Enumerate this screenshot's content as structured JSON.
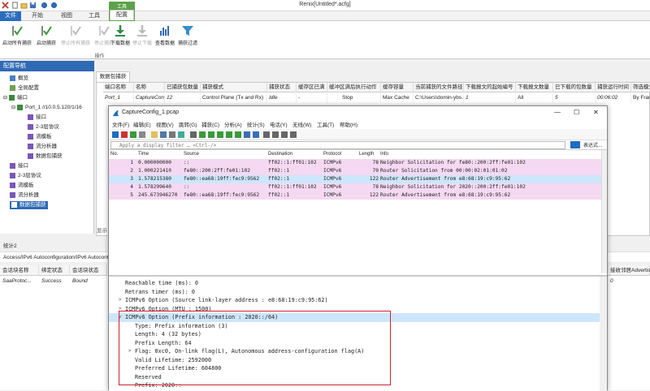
{
  "app": {
    "title": "Renix[Untitled*.acfg]"
  },
  "ribbon": {
    "tabs": [
      "文件",
      "开始",
      "视图",
      "工具",
      "配置"
    ],
    "context_tab": "工具",
    "buttons": [
      {
        "label": "启动所有捕获",
        "icon": "start-all-capture-icon",
        "enabled": true
      },
      {
        "label": "启动捕获",
        "icon": "start-capture-icon",
        "enabled": true
      },
      {
        "label": "停止所有捕获",
        "icon": "stop-all-capture-icon",
        "enabled": false
      },
      {
        "label": "停止捕获",
        "icon": "stop-capture-icon",
        "enabled": false
      },
      {
        "label": "下载数据",
        "icon": "download-data-icon",
        "enabled": true
      },
      {
        "label": "停止下载",
        "icon": "stop-download-icon",
        "enabled": false
      },
      {
        "label": "查看数据",
        "icon": "view-data-icon",
        "enabled": true
      },
      {
        "label": "捕获过滤",
        "icon": "capture-filter-icon",
        "enabled": true
      }
    ],
    "group_label": "操作"
  },
  "nav": {
    "header": "配置导航",
    "items": [
      {
        "label": "概览",
        "indent": 0
      },
      {
        "label": "全局配置",
        "indent": 0
      },
      {
        "label": "端口",
        "indent": 0
      },
      {
        "label": "Port_1 //10.0.5.120/1/16",
        "indent": 1
      },
      {
        "label": "接口",
        "indent": 2
      },
      {
        "label": "2-3层协议",
        "indent": 2
      },
      {
        "label": "流模板",
        "indent": 2
      },
      {
        "label": "流分析器",
        "indent": 2
      },
      {
        "label": "数据包捕获",
        "indent": 2
      },
      {
        "label": "接口",
        "indent": 0
      },
      {
        "label": "2-3层协议",
        "indent": 0
      },
      {
        "label": "流模板",
        "indent": 0
      },
      {
        "label": "流分析器",
        "indent": 0
      },
      {
        "label": "数据包捕获",
        "indent": 0,
        "selected": true
      }
    ]
  },
  "capture_panel": {
    "tab": "数据包捕获",
    "columns": [
      "端口名称",
      "名称",
      "已捕获包数量",
      "捕获模式",
      "捕获状态",
      "缓存区已满",
      "缓冲区满后执行动作",
      "缓存容量",
      "当前捕获的文件路径",
      "下载报文的起始编号",
      "下载报文数量",
      "已下载的包数量",
      "捕获运行时间",
      "筛选模式"
    ],
    "row": [
      "Port_1",
      "CaptureConf...",
      "12",
      "Control Plane (Tx and Rx)",
      "Idle",
      "-",
      "Stop",
      "Max Cache",
      "C:\\Users\\domin-ybs...",
      "1",
      "All",
      "5",
      "00:06:02",
      "By Fram"
    ],
    "side_label": "显示"
  },
  "stats": {
    "title": "统计2",
    "path": "Access/IPv6 Autoconfiguration/IPv6 Autoconfig",
    "columns": [
      "会话块名称",
      "绑定状态",
      "会话块状态"
    ],
    "row": [
      "SaaProtoc...",
      "Success",
      "Bound"
    ],
    "extra_col": "接收邻居Advertis",
    "extra_val": "0"
  },
  "wireshark": {
    "title": "CaptureConfig_1.pcap",
    "menu": [
      "文件(F)",
      "编辑(E)",
      "视图(V)",
      "跳转(G)",
      "捕获(C)",
      "分析(A)",
      "统计(S)",
      "电话(Y)",
      "无线(W)",
      "工具(T)",
      "帮助(H)"
    ],
    "filter_placeholder": "Apply a display filter … <Ctrl-/>",
    "expression_label": "表达式…",
    "packet_columns": [
      "No.",
      "Time",
      "Source",
      "Destination",
      "Protocol",
      "Length",
      "Info"
    ],
    "packets": [
      {
        "no": "1",
        "time": "0.000000000",
        "src": "::",
        "dst": "ff02::1:ff01:102",
        "proto": "ICMPv6",
        "len": "78",
        "info": "Neighbor Solicitation for fe80::200:2ff:fe01:102"
      },
      {
        "no": "2",
        "time": "1.000221410",
        "src": "fe80::200:2ff:fe01:102",
        "dst": "ff02::1",
        "proto": "ICMPv6",
        "len": "70",
        "info": "Router Solicitation from 00:00:02:01:01:02"
      },
      {
        "no": "3",
        "time": "1.578215380",
        "src": "fe80::ea68:19ff:fec9:9562",
        "dst": "ff02::1",
        "proto": "ICMPv6",
        "len": "122",
        "info": "Router Advertisement from e8:68:19:c9:95:62"
      },
      {
        "no": "4",
        "time": "1.578299640",
        "src": "::",
        "dst": "ff02::1:ff01:102",
        "proto": "ICMPv6",
        "len": "78",
        "info": "Neighbor Solicitation for 2020::200:2ff:fe01:102"
      },
      {
        "no": "5",
        "time": "245.673946270",
        "src": "fe80::ea68:19ff:fec9:9562",
        "dst": "ff02::1",
        "proto": "ICMPv6",
        "len": "122",
        "info": "Router Advertisement from e8:68:19:c9:95:62"
      }
    ],
    "selected_packet": "3",
    "detail_lines": [
      {
        "text": "Reachable time (ms): 0",
        "indent": 1,
        "arrow": ""
      },
      {
        "text": "Retrans timer (ms): 0",
        "indent": 1,
        "arrow": ""
      },
      {
        "text": "ICMPv6 Option (Source link-layer address : e8:68:19:c9:95:62)",
        "indent": 1,
        "arrow": ">"
      },
      {
        "text": "ICMPv6 Option (MTU : 1500)",
        "indent": 1,
        "arrow": ">"
      },
      {
        "text": "ICMPv6 Option (Prefix information : 2020::/64)",
        "indent": 1,
        "arrow": "v",
        "highlight": true
      },
      {
        "text": "Type: Prefix information (3)",
        "indent": 2,
        "arrow": ""
      },
      {
        "text": "Length: 4 (32 bytes)",
        "indent": 2,
        "arrow": ""
      },
      {
        "text": "Prefix Length: 64",
        "indent": 2,
        "arrow": ""
      },
      {
        "text": "Flag: 0xc0, On-link flag(L), Autonomous address-configuration flag(A)",
        "indent": 2,
        "arrow": ">"
      },
      {
        "text": "Valid Lifetime: 2592000",
        "indent": 2,
        "arrow": ""
      },
      {
        "text": "Preferred Lifetime: 604800",
        "indent": 2,
        "arrow": ""
      },
      {
        "text": "Reserved",
        "indent": 2,
        "arrow": ""
      },
      {
        "text": "Prefix: 2020::",
        "indent": 2,
        "arrow": ""
      }
    ]
  },
  "colors": {
    "accent": "#2f6ab5",
    "row_pink": "#f5d9f2",
    "row_selected": "#cde6fb",
    "highlight_box": "#d2202f",
    "ribbon_green": "#5ba349"
  }
}
